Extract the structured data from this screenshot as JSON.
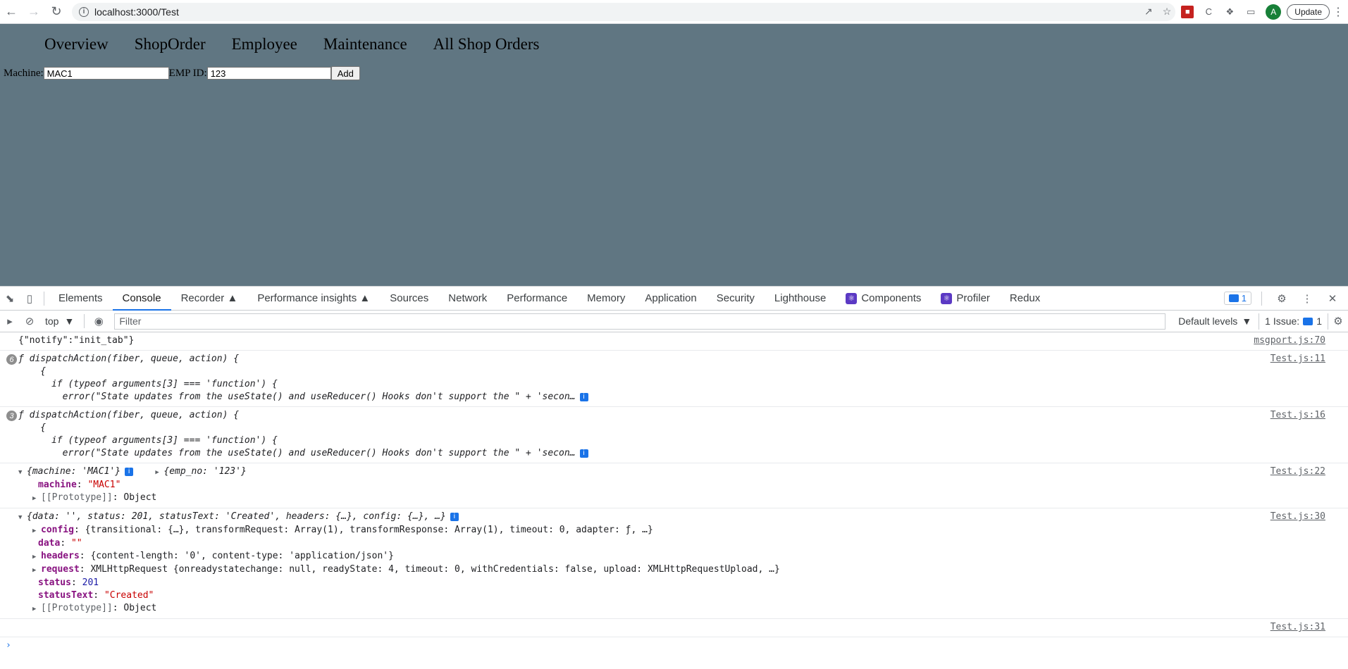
{
  "browser": {
    "url": "localhost:3000/Test",
    "profile_initial": "A",
    "update_label": "Update"
  },
  "app": {
    "nav": [
      "Overview",
      "ShopOrder",
      "Employee",
      "Maintenance",
      "All Shop Orders"
    ],
    "form": {
      "machine_label": "Machine:",
      "machine_value": "MAC1",
      "emp_label": "EMP ID:",
      "emp_value": "123",
      "add_label": "Add"
    }
  },
  "devtools": {
    "tabs": [
      "Elements",
      "Console",
      "Recorder",
      "Performance insights",
      "Sources",
      "Network",
      "Performance",
      "Memory",
      "Application",
      "Security",
      "Lighthouse",
      "Components",
      "Profiler",
      "Redux"
    ],
    "active_tab": "Console",
    "messages_count": "1",
    "context": "top",
    "filter_placeholder": "Filter",
    "levels": "Default levels",
    "issues_label": "1 Issue:",
    "issues_count": "1"
  },
  "console": {
    "e1": {
      "text": "{\"notify\":\"init_tab\"}",
      "src": "msgport.js:70"
    },
    "e2": {
      "count": "6",
      "l1": "ƒ dispatchAction(fiber, queue, action) {",
      "l2": "    {",
      "l3": "      if (typeof arguments[3] === 'function') {",
      "l4": "        error(\"State updates from the useState() and useReducer() Hooks don't support the \" + 'secon…",
      "src": "Test.js:11"
    },
    "e3": {
      "count": "3",
      "l1": "ƒ dispatchAction(fiber, queue, action) {",
      "l2": "    {",
      "l3": "      if (typeof arguments[3] === 'function') {",
      "l4": "        error(\"State updates from the useState() and useReducer() Hooks don't support the \" + 'secon…",
      "src": "Test.js:16"
    },
    "e4": {
      "summary_a": "{machine: 'MAC1'}",
      "summary_b": "{emp_no: '123'}",
      "key_machine": "machine",
      "val_machine": "\"MAC1\"",
      "proto": "[[Prototype]]",
      "proto_val": "Object",
      "src": "Test.js:22"
    },
    "e5": {
      "summary": "{data: '', status: 201, statusText: 'Created', headers: {…}, config: {…}, …}",
      "config_key": "config",
      "config_val": "{transitional: {…}, transformRequest: Array(1), transformResponse: Array(1), timeout: 0, adapter: ƒ, …}",
      "data_key": "data",
      "data_val": "\"\"",
      "headers_key": "headers",
      "headers_val": "{content-length: '0', content-type: 'application/json'}",
      "request_key": "request",
      "request_val": "XMLHttpRequest {onreadystatechange: null, readyState: 4, timeout: 0, withCredentials: false, upload: XMLHttpRequestUpload, …}",
      "status_key": "status",
      "status_val": "201",
      "statusText_key": "statusText",
      "statusText_val": "\"Created\"",
      "proto": "[[Prototype]]",
      "proto_val": "Object",
      "src": "Test.js:30"
    },
    "e6": {
      "src": "Test.js:31"
    }
  }
}
